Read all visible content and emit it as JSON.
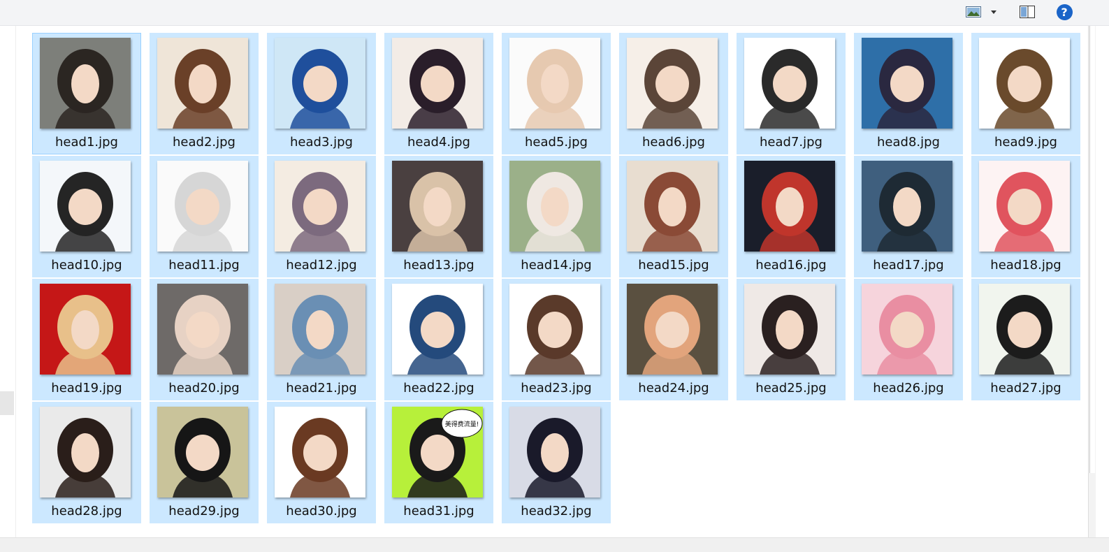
{
  "toolbar": {
    "view_icon": "thumbnail-view-icon",
    "dropdown_icon": "chevron-down-icon",
    "pane_icon": "preview-pane-icon",
    "help_icon": "help-icon",
    "help_glyph": "?",
    "accent": "#1a64c8"
  },
  "colors": {
    "selection": "#cce8ff",
    "focus_border": "#99d1ff"
  },
  "files": [
    {
      "name": "head1.jpg",
      "icon": "image-thumbnail",
      "bg": "#7d7f7a",
      "fg": "#2b2622",
      "kind": "photo"
    },
    {
      "name": "head2.jpg",
      "icon": "image-thumbnail",
      "bg": "#efe5d8",
      "fg": "#6a4028",
      "kind": "photo"
    },
    {
      "name": "head3.jpg",
      "icon": "image-thumbnail",
      "bg": "#cfe7f6",
      "fg": "#1f4f9c",
      "kind": "anime"
    },
    {
      "name": "head4.jpg",
      "icon": "image-thumbnail",
      "bg": "#f3ece6",
      "fg": "#2a1e2a",
      "kind": "anime"
    },
    {
      "name": "head5.jpg",
      "icon": "image-thumbnail",
      "bg": "#fbfbfb",
      "fg": "#e6c9b0",
      "kind": "photo"
    },
    {
      "name": "head6.jpg",
      "icon": "image-thumbnail",
      "bg": "#f6efe8",
      "fg": "#5b4538",
      "kind": "anime"
    },
    {
      "name": "head7.jpg",
      "icon": "image-thumbnail",
      "bg": "#ffffff",
      "fg": "#2a2a2a",
      "kind": "anime"
    },
    {
      "name": "head8.jpg",
      "icon": "image-thumbnail",
      "bg": "#2e6fa8",
      "fg": "#2a2840",
      "kind": "anime"
    },
    {
      "name": "head9.jpg",
      "icon": "image-thumbnail",
      "bg": "#ffffff",
      "fg": "#6a4a2c",
      "kind": "anime"
    },
    {
      "name": "head10.jpg",
      "icon": "image-thumbnail",
      "bg": "#f4f7fa",
      "fg": "#252525",
      "kind": "anime"
    },
    {
      "name": "head11.jpg",
      "icon": "image-thumbnail",
      "bg": "#fafafa",
      "fg": "#d6d6d6",
      "kind": "anime"
    },
    {
      "name": "head12.jpg",
      "icon": "image-thumbnail",
      "bg": "#f4ece2",
      "fg": "#7c6a7e",
      "kind": "anime"
    },
    {
      "name": "head13.jpg",
      "icon": "image-thumbnail",
      "bg": "#4a4040",
      "fg": "#d9c2a8",
      "kind": "photo"
    },
    {
      "name": "head14.jpg",
      "icon": "image-thumbnail",
      "bg": "#9bb089",
      "fg": "#efe8e2",
      "kind": "photo"
    },
    {
      "name": "head15.jpg",
      "icon": "image-thumbnail",
      "bg": "#e8ddd0",
      "fg": "#8a4a36",
      "kind": "photo"
    },
    {
      "name": "head16.jpg",
      "icon": "image-thumbnail",
      "bg": "#1a1e2a",
      "fg": "#c0352c",
      "kind": "photo"
    },
    {
      "name": "head17.jpg",
      "icon": "image-thumbnail",
      "bg": "#3f5f7e",
      "fg": "#1e2a34",
      "kind": "photo"
    },
    {
      "name": "head18.jpg",
      "icon": "image-thumbnail",
      "bg": "#fdf3f3",
      "fg": "#e0545e",
      "kind": "anime"
    },
    {
      "name": "head19.jpg",
      "icon": "image-thumbnail",
      "bg": "#c51717",
      "fg": "#e8c08a",
      "kind": "photo"
    },
    {
      "name": "head20.jpg",
      "icon": "image-thumbnail",
      "bg": "#6e6a68",
      "fg": "#e7d2c4",
      "kind": "anime"
    },
    {
      "name": "head21.jpg",
      "icon": "image-thumbnail",
      "bg": "#d9cfc6",
      "fg": "#6a8fb4",
      "kind": "photo"
    },
    {
      "name": "head22.jpg",
      "icon": "image-thumbnail",
      "bg": "#ffffff",
      "fg": "#244a7c",
      "kind": "anime"
    },
    {
      "name": "head23.jpg",
      "icon": "image-thumbnail",
      "bg": "#ffffff",
      "fg": "#5a3a2a",
      "kind": "anime"
    },
    {
      "name": "head24.jpg",
      "icon": "image-thumbnail",
      "bg": "#5a5040",
      "fg": "#e2a47c",
      "kind": "anime"
    },
    {
      "name": "head25.jpg",
      "icon": "image-thumbnail",
      "bg": "#efe9e6",
      "fg": "#2a2020",
      "kind": "photo"
    },
    {
      "name": "head26.jpg",
      "icon": "image-thumbnail",
      "bg": "#f6d4dc",
      "fg": "#e98ea2",
      "kind": "anime"
    },
    {
      "name": "head27.jpg",
      "icon": "image-thumbnail",
      "bg": "#f1f5ee",
      "fg": "#1c1c1c",
      "kind": "anime"
    },
    {
      "name": "head28.jpg",
      "icon": "image-thumbnail",
      "bg": "#eaeaea",
      "fg": "#2a1e1a",
      "kind": "photo"
    },
    {
      "name": "head29.jpg",
      "icon": "image-thumbnail",
      "bg": "#c9c39a",
      "fg": "#161616",
      "kind": "anime"
    },
    {
      "name": "head30.jpg",
      "icon": "image-thumbnail",
      "bg": "#ffffff",
      "fg": "#6a3a22",
      "kind": "anime"
    },
    {
      "name": "head31.jpg",
      "icon": "image-thumbnail",
      "bg": "#b7f03a",
      "fg": "#1a1a1a",
      "kind": "anime",
      "caption": "美得费流量!"
    },
    {
      "name": "head32.jpg",
      "icon": "image-thumbnail",
      "bg": "#d8dbe6",
      "fg": "#1a1a2a",
      "kind": "photo"
    }
  ]
}
